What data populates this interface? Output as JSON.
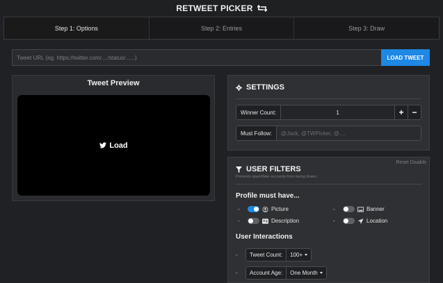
{
  "header": {
    "title": "RETWEET PICKER"
  },
  "tabs": [
    {
      "label": "Step 1: Options",
      "active": true
    },
    {
      "label": "Step 2: Entries",
      "active": false
    },
    {
      "label": "Step 3: Draw",
      "active": false
    }
  ],
  "url_input": {
    "placeholder": "Tweet URL (eg. https://twitter.com/..../status/......)",
    "value": ""
  },
  "load_tweet_button": "LOAD TWEET",
  "preview": {
    "title": "Tweet Preview",
    "load_label": "Load"
  },
  "settings": {
    "title": "SETTINGS",
    "winner_count": {
      "label": "Winner Count:",
      "value": "1",
      "plus": "+",
      "minus": "−"
    },
    "must_follow": {
      "label": "Must Follow:",
      "placeholder": "@Jack, @TWPicker, @...."
    }
  },
  "filters": {
    "title": "USER FILTERS",
    "reset": "Reset",
    "disable": "Disable",
    "subtitle": "Prevents spam/fake accounts from being drawn.",
    "profile_heading": "Profile must have...",
    "profile_options": [
      {
        "label": "Picture",
        "on": true,
        "icon": "user-circle-icon"
      },
      {
        "label": "Banner",
        "on": false,
        "icon": "image-icon"
      },
      {
        "label": "Description",
        "on": false,
        "icon": "id-card-icon"
      },
      {
        "label": "Location",
        "on": false,
        "icon": "location-arrow-icon"
      }
    ],
    "interactions_heading": "User Interactions",
    "tweet_count": {
      "label": "Tweet Count:",
      "value": "100+"
    },
    "account_age": {
      "label": "Account Age:",
      "value": "One Month"
    }
  },
  "colors": {
    "accent": "#1e88e5",
    "background": "#202124",
    "panel": "#2e3033"
  }
}
